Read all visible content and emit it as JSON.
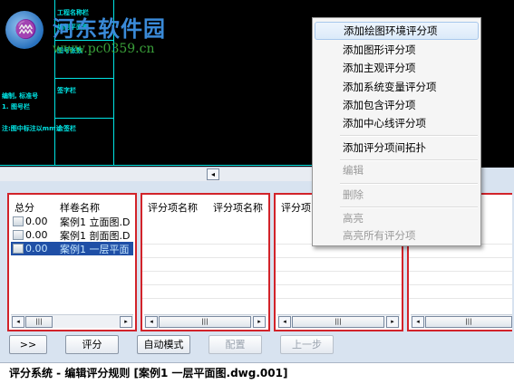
{
  "watermark": {
    "title": "河东软件园",
    "url": "www.pc0359.cn",
    "logo_glyph": "♒"
  },
  "cad": {
    "labels": [
      "工程名称栏",
      "编制平面图",
      "图号张数",
      "签字栏",
      "会签栏"
    ],
    "notes": [
      "编制, 标准号",
      "1. 图号栏",
      "注:图中标注以mm计"
    ]
  },
  "hscroll": {
    "arrow": "◂"
  },
  "panel1": {
    "headers": [
      "总分",
      "样卷名称"
    ],
    "rows": [
      {
        "score": "0.00",
        "name": "案例1 立面图.D",
        "selected": false
      },
      {
        "score": "0.00",
        "name": "案例1 剖面图.D",
        "selected": false
      },
      {
        "score": "0.00",
        "name": "案例1 一层平面",
        "selected": true
      }
    ]
  },
  "panel2": {
    "headers": [
      "评分项名称",
      "评分项名称"
    ]
  },
  "panel3": {
    "headers": [
      "评分项"
    ]
  },
  "scroll": {
    "left": "◂",
    "right": "▸",
    "grip": "|||"
  },
  "buttons": {
    "expand": ">>",
    "score": "评分",
    "auto": "自动模式",
    "config": "配置",
    "prev": "上一步"
  },
  "status": "评分系统 - 编辑评分规则 [案例1 一层平面图.dwg.001]",
  "menu": {
    "items": [
      "添加绘图环境评分项",
      "添加图形评分项",
      "添加主观评分项",
      "添加系统变量评分项",
      "添加包含评分项",
      "添加中心线评分项",
      "添加评分项间拓扑",
      "编辑",
      "删除",
      "高亮",
      "高亮所有评分项"
    ]
  }
}
